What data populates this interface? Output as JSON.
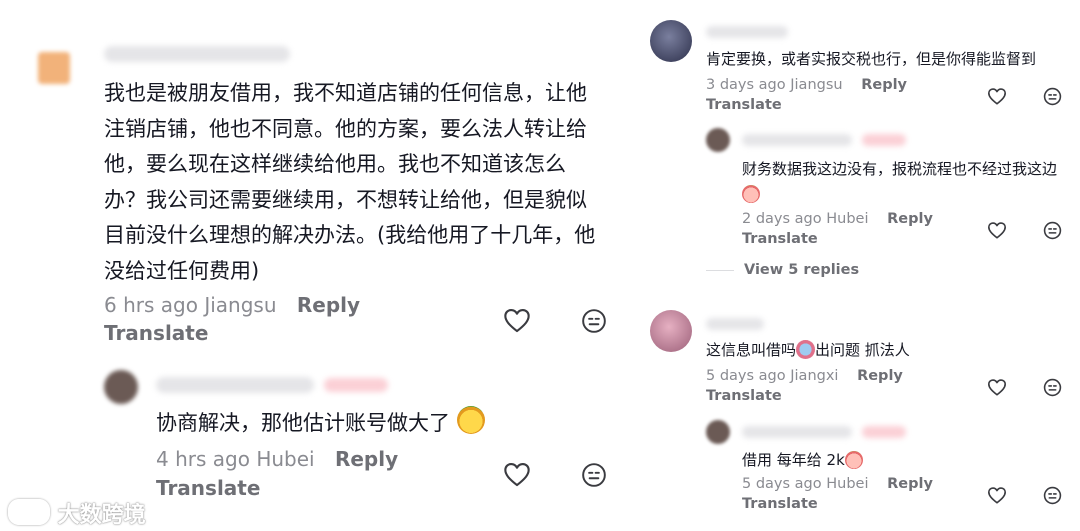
{
  "left": {
    "main_comment": {
      "text": "我也是被朋友借用，我不知道店铺的任何信息，让他注销店铺，他也不同意。他的方案，要么法人转让给他，要么现在这样继续给他用。我也不知道该怎么办？我公司还需要继续用，不想转让给他，但是貌似目前没什么理想的解决办法。(我给他用了十几年，他没给过任何费用)",
      "time": "6 hrs ago",
      "location": "Jiangsu",
      "reply_label": "Reply",
      "translate_label": "Translate"
    },
    "reply": {
      "text": "协商解决，那他估计账号做大了",
      "time": "4 hrs ago",
      "location": "Hubei",
      "reply_label": "Reply",
      "translate_label": "Translate"
    }
  },
  "right": {
    "comment1": {
      "text": "肯定要换，或者实报交税也行，但是你得能监督到",
      "time": "3 days ago",
      "location": "Jiangsu",
      "reply_label": "Reply",
      "translate_label": "Translate"
    },
    "reply1": {
      "text": "财务数据我这边没有，报税流程也不经过我这边",
      "time": "2 days ago",
      "location": "Hubei",
      "reply_label": "Reply",
      "translate_label": "Translate"
    },
    "view_replies": "View 5 replies",
    "comment2": {
      "text_a": "这信息叫借吗",
      "text_b": "出问题 抓法人",
      "time": "5 days ago",
      "location": "Jiangxi",
      "reply_label": "Reply",
      "translate_label": "Translate"
    },
    "reply2": {
      "text": "借用 每年给 2k",
      "time": "5 days ago",
      "location": "Hubei",
      "reply_label": "Reply",
      "translate_label": "Translate"
    }
  },
  "icons": {
    "like": "heart-outline-icon",
    "dislike": "neutral-face-icon",
    "emoji": "emoji-sticker"
  },
  "watermark": "大数跨境",
  "colors": {
    "text": "#161823",
    "meta": "#8a8b91",
    "action": "#6e6f75",
    "author_tag": "#fbd0d6"
  }
}
